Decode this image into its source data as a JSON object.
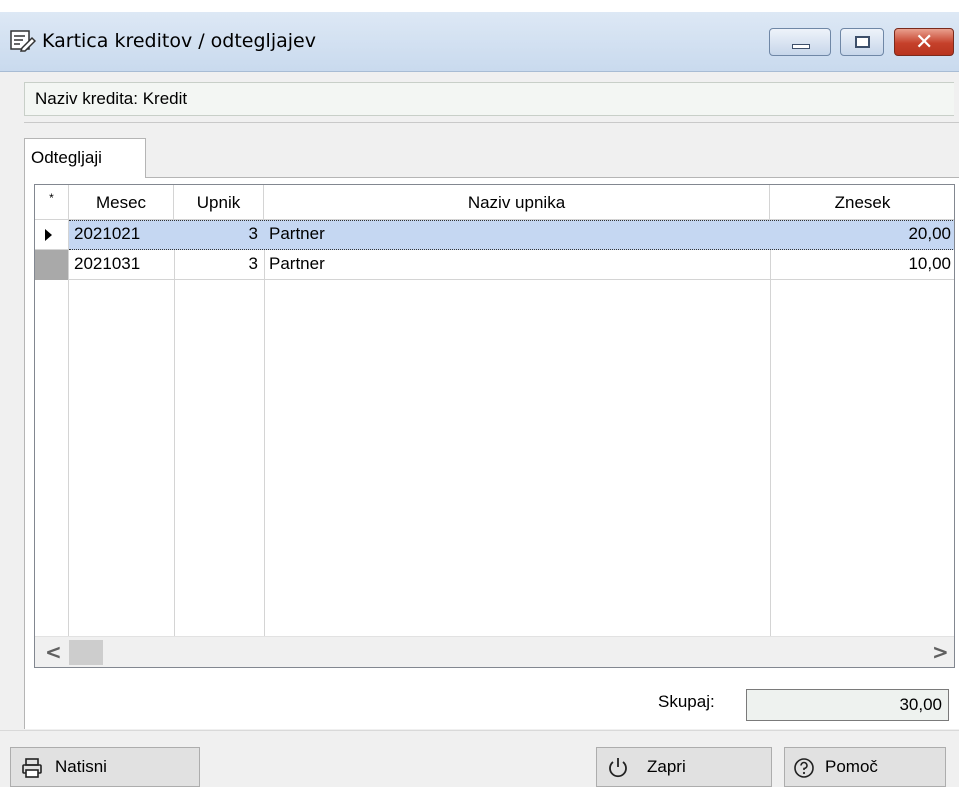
{
  "window": {
    "title": "Kartica kreditov / odtegljajev",
    "icon": "edit-form-icon",
    "controls": {
      "minimize": "minimize-icon",
      "maximize": "maximize-icon",
      "close": "✕"
    }
  },
  "credit": {
    "label_with_value": "Naziv kredita: Kredit"
  },
  "tabs": [
    {
      "label": "Odtegljaji",
      "active": true
    }
  ],
  "grid": {
    "indicator_header": "*",
    "columns": [
      "Mesec",
      "Upnik",
      "Naziv upnika",
      "Znesek"
    ],
    "rows": [
      {
        "mesec": "2021021",
        "upnik": "3",
        "naziv": "Partner",
        "znesek": "20,00",
        "selected": true
      },
      {
        "mesec": "2021031",
        "upnik": "3",
        "naziv": "Partner",
        "znesek": "10,00",
        "selected": false
      }
    ],
    "scroll_left": "<",
    "scroll_right": ">"
  },
  "totals": {
    "label": "Skupaj:",
    "value": "30,00"
  },
  "buttons": {
    "print": {
      "label": "Natisni",
      "icon": "printer-icon"
    },
    "close": {
      "label": "Zapri",
      "icon": "power-icon"
    },
    "help": {
      "label": "Pomoč",
      "icon": "help-icon"
    }
  },
  "colors": {
    "selection": "#c5d7f2",
    "titlebar": "#c9daee",
    "close_button": "#c5402a"
  }
}
